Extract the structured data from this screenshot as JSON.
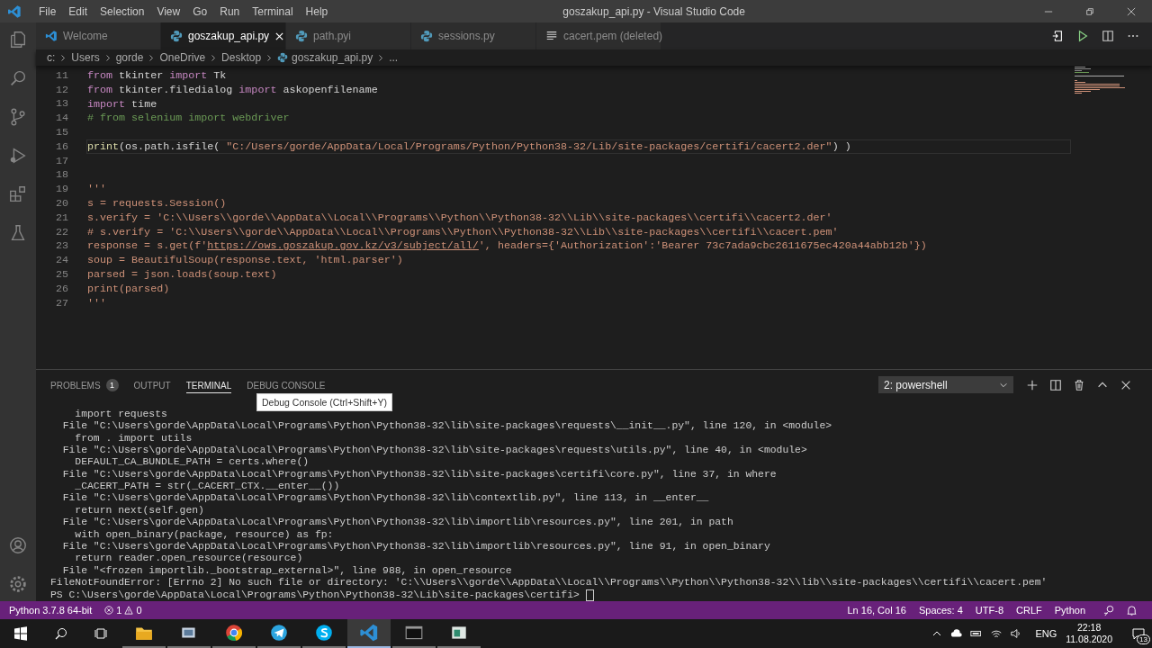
{
  "title_bar": {
    "menu": [
      "File",
      "Edit",
      "Selection",
      "View",
      "Go",
      "Run",
      "Terminal",
      "Help"
    ],
    "title": "goszakup_api.py - Visual Studio Code"
  },
  "tabs": [
    {
      "label": "Welcome",
      "kind": "vscode",
      "selected": false
    },
    {
      "label": "goszakup_api.py",
      "kind": "python",
      "selected": true
    },
    {
      "label": "path.pyi",
      "kind": "python",
      "selected": false
    },
    {
      "label": "sessions.py",
      "kind": "python",
      "selected": false
    },
    {
      "label": "cacert.pem (deleted)",
      "kind": "text",
      "selected": false
    }
  ],
  "breadcrumb": {
    "items": [
      {
        "label": "c:",
        "kind": "folder"
      },
      {
        "label": "Users",
        "kind": "folder"
      },
      {
        "label": "gorde",
        "kind": "folder"
      },
      {
        "label": "OneDrive",
        "kind": "folder"
      },
      {
        "label": "Desktop",
        "kind": "folder"
      },
      {
        "label": "goszakup_api.py",
        "kind": "python"
      }
    ],
    "tail": "..."
  },
  "editor": {
    "lines": [
      {
        "number": "11",
        "current": false,
        "tokens": [
          {
            "kind": "kw",
            "text": "from"
          },
          {
            "kind": "txt",
            "text": " tkinter "
          },
          {
            "kind": "kw",
            "text": "import"
          },
          {
            "kind": "txt",
            "text": " Tk"
          }
        ]
      },
      {
        "number": "12",
        "current": false,
        "tokens": [
          {
            "kind": "kw",
            "text": "from"
          },
          {
            "kind": "txt",
            "text": " tkinter.filedialog "
          },
          {
            "kind": "kw",
            "text": "import"
          },
          {
            "kind": "txt",
            "text": " askopenfilename"
          }
        ]
      },
      {
        "number": "13",
        "current": false,
        "tokens": [
          {
            "kind": "kw",
            "text": "import"
          },
          {
            "kind": "txt",
            "text": " time"
          }
        ]
      },
      {
        "number": "14",
        "current": false,
        "tokens": [
          {
            "kind": "com",
            "text": "# from selenium import webdriver"
          }
        ]
      },
      {
        "number": "15",
        "current": false
      },
      {
        "number": "16",
        "current": true,
        "tokens": [
          {
            "kind": "fn",
            "text": "print"
          },
          {
            "kind": "txt",
            "text": "(os.path.isfile( "
          },
          {
            "kind": "str",
            "text": "\"C:/Users/gorde/AppData/Local/Programs/Python/Python38-32/Lib/site-packages/certifi/cacert2.der\""
          },
          {
            "kind": "txt",
            "text": ") )"
          }
        ]
      },
      {
        "number": "17",
        "current": false
      },
      {
        "number": "18",
        "current": false
      },
      {
        "number": "19",
        "current": false,
        "tokens": [
          {
            "kind": "str",
            "text": "'''"
          }
        ]
      },
      {
        "number": "20",
        "current": false,
        "tokens": [
          {
            "kind": "str",
            "text": "s = requests.Session()"
          }
        ]
      },
      {
        "number": "21",
        "current": false,
        "tokens": [
          {
            "kind": "str",
            "text": "s.verify = 'C:\\\\Users\\\\gorde\\\\AppData\\\\Local\\\\Programs\\\\Python\\\\Python38-32\\\\Lib\\\\site-packages\\\\certifi\\\\cacert2.der'"
          }
        ]
      },
      {
        "number": "22",
        "current": false,
        "tokens": [
          {
            "kind": "str",
            "text": "# s.verify = 'C:\\\\Users\\\\gorde\\\\AppData\\\\Local\\\\Programs\\\\Python\\\\Python38-32\\\\Lib\\\\site-packages\\\\certifi\\\\cacert.pem'"
          }
        ]
      },
      {
        "number": "23",
        "current": false,
        "tokens": [
          {
            "kind": "str",
            "text": "response = s.get(f'"
          },
          {
            "kind": "url",
            "text": "https://ows.goszakup.gov.kz/v3/subject/all/"
          },
          {
            "kind": "str",
            "text": "', headers={'Authorization':'Bearer 73c7ada9cbc2611675ec420a44abb12b'})"
          }
        ]
      },
      {
        "number": "24",
        "current": false,
        "tokens": [
          {
            "kind": "str",
            "text": "soup = BeautifulSoup(response.text, 'html.parser')"
          }
        ]
      },
      {
        "number": "25",
        "current": false,
        "tokens": [
          {
            "kind": "str",
            "text": "parsed = json.loads(soup.text)"
          }
        ]
      },
      {
        "number": "26",
        "current": false,
        "tokens": [
          {
            "kind": "str",
            "text": "print(parsed)"
          }
        ]
      },
      {
        "number": "27",
        "current": false,
        "tokens": [
          {
            "kind": "str",
            "text": "'''"
          }
        ]
      }
    ]
  },
  "panel": {
    "tabs": [
      {
        "label": "PROBLEMS",
        "badge": "1",
        "selected": false
      },
      {
        "label": "OUTPUT",
        "selected": false
      },
      {
        "label": "TERMINAL",
        "selected": true
      },
      {
        "label": "DEBUG CONSOLE",
        "selected": false
      }
    ],
    "tooltip": "Debug Console (Ctrl+Shift+Y)",
    "terminal_select": "2: powershell",
    "terminal_lines": [
      "    import requests",
      "  File \"C:\\Users\\gorde\\AppData\\Local\\Programs\\Python\\Python38-32\\lib\\site-packages\\requests\\__init__.py\", line 120, in <module>",
      "    from . import utils",
      "  File \"C:\\Users\\gorde\\AppData\\Local\\Programs\\Python\\Python38-32\\lib\\site-packages\\requests\\utils.py\", line 40, in <module>",
      "    DEFAULT_CA_BUNDLE_PATH = certs.where()",
      "  File \"C:\\Users\\gorde\\AppData\\Local\\Programs\\Python\\Python38-32\\lib\\site-packages\\certifi\\core.py\", line 37, in where",
      "    _CACERT_PATH = str(_CACERT_CTX.__enter__())",
      "  File \"C:\\Users\\gorde\\AppData\\Local\\Programs\\Python\\Python38-32\\lib\\contextlib.py\", line 113, in __enter__",
      "    return next(self.gen)",
      "  File \"C:\\Users\\gorde\\AppData\\Local\\Programs\\Python\\Python38-32\\lib\\importlib\\resources.py\", line 201, in path",
      "    with open_binary(package, resource) as fp:",
      "  File \"C:\\Users\\gorde\\AppData\\Local\\Programs\\Python\\Python38-32\\lib\\importlib\\resources.py\", line 91, in open_binary",
      "    return reader.open_resource(resource)",
      "  File \"<frozen importlib._bootstrap_external>\", line 988, in open_resource",
      "FileNotFoundError: [Errno 2] No such file or directory: 'C:\\\\Users\\\\gorde\\\\AppData\\\\Local\\\\Programs\\\\Python\\\\Python38-32\\\\lib\\\\site-packages\\\\certifi\\\\cacert.pem'"
    ],
    "prompt": "PS C:\\Users\\gorde\\AppData\\Local\\Programs\\Python\\Python38-32\\Lib\\site-packages\\certifi> "
  },
  "status_bar": {
    "interpreter": "Python 3.7.8 64-bit",
    "errors": "1",
    "warnings": "0",
    "right": [
      "Ln 16, Col 16",
      "Spaces: 4",
      "UTF-8",
      "CRLF",
      "Python"
    ]
  },
  "taskbar": {
    "apps": [
      {
        "kind": "explorer",
        "active": false
      },
      {
        "kind": "window",
        "active": false
      },
      {
        "kind": "chrome",
        "active": false
      },
      {
        "kind": "telegram",
        "active": false
      },
      {
        "kind": "skype",
        "active": false
      },
      {
        "kind": "vscode",
        "active": true
      },
      {
        "kind": "terminal",
        "active": false
      },
      {
        "kind": "app",
        "active": false
      }
    ],
    "language": "ENG",
    "time": "22:18",
    "date": "11.08.2020",
    "notifications": "13"
  }
}
